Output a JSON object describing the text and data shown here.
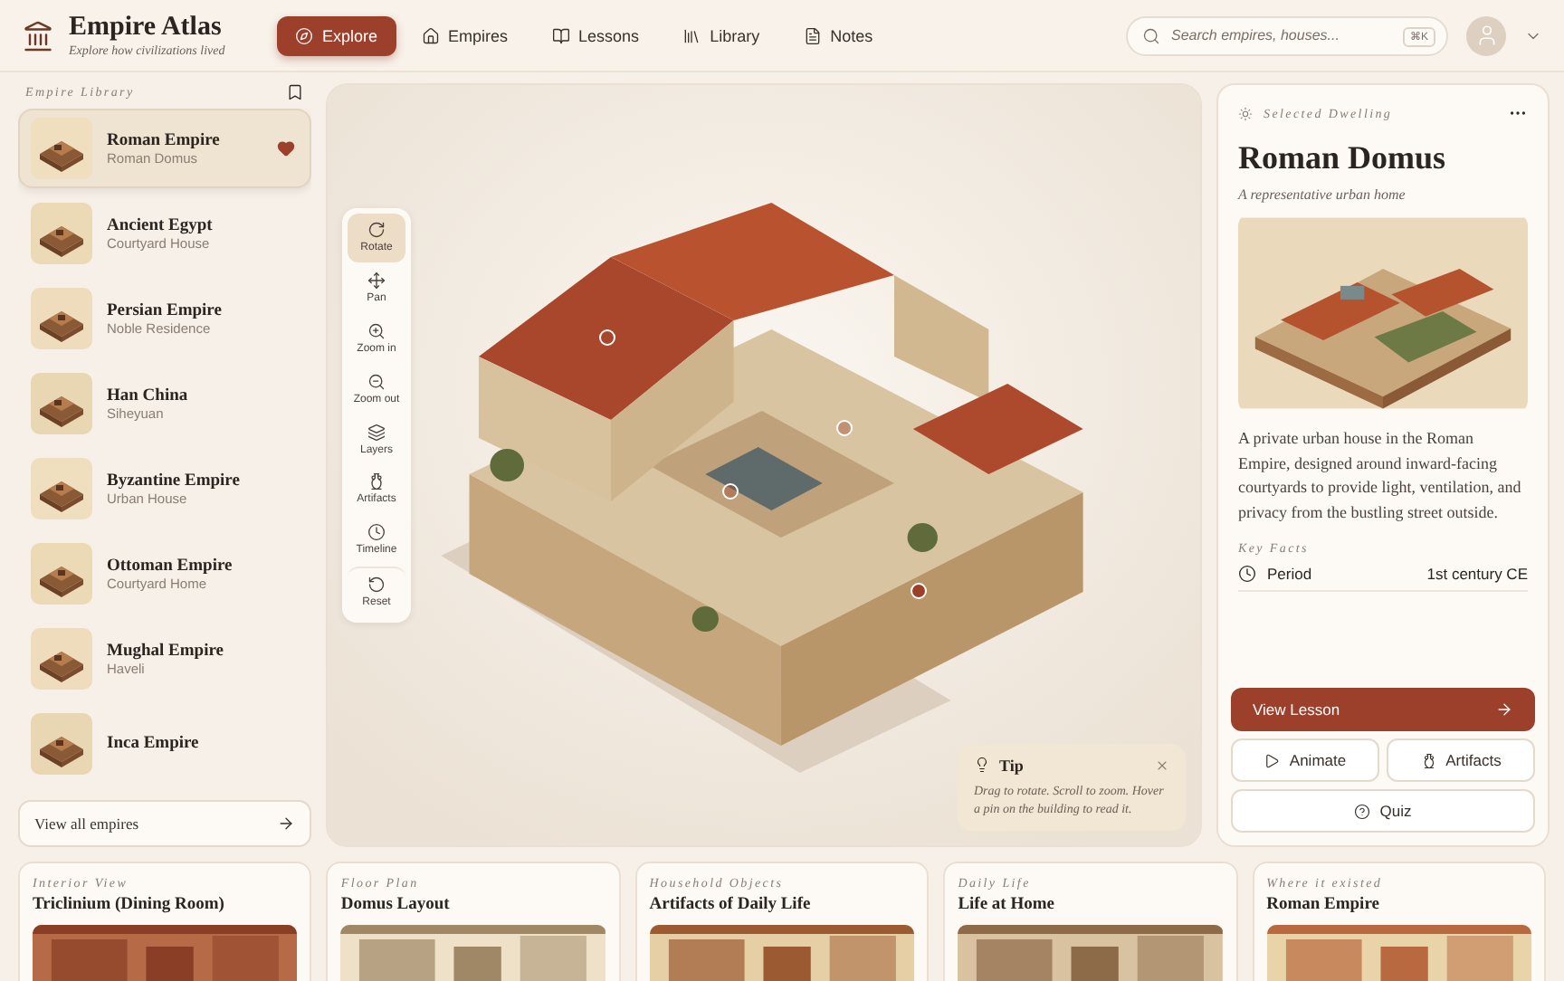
{
  "header": {
    "title": "Empire Atlas",
    "subtitle": "Explore how civilizations lived",
    "nav": [
      {
        "label": "Explore",
        "selected": true
      },
      {
        "label": "Empires",
        "selected": false
      },
      {
        "label": "Lessons",
        "selected": false
      },
      {
        "label": "Library",
        "selected": false
      },
      {
        "label": "Notes",
        "selected": false
      }
    ],
    "search": {
      "placeholder": "Search empires, houses...",
      "shortcut": "⌘K"
    }
  },
  "sidebar": {
    "heading": "Empire Library",
    "items": [
      {
        "name": "Roman Empire",
        "dwelling": "Roman Domus",
        "selected": true,
        "favorite": true
      },
      {
        "name": "Ancient Egypt",
        "dwelling": "Courtyard House",
        "selected": false,
        "favorite": false
      },
      {
        "name": "Persian Empire",
        "dwelling": "Noble Residence",
        "selected": false,
        "favorite": false
      },
      {
        "name": "Han China",
        "dwelling": "Siheyuan",
        "selected": false,
        "favorite": false
      },
      {
        "name": "Byzantine Empire",
        "dwelling": "Urban House",
        "selected": false,
        "favorite": false
      },
      {
        "name": "Ottoman Empire",
        "dwelling": "Courtyard Home",
        "selected": false,
        "favorite": false
      },
      {
        "name": "Mughal Empire",
        "dwelling": "Haveli",
        "selected": false,
        "favorite": false
      },
      {
        "name": "Inca Empire",
        "selected": false,
        "favorite": false
      }
    ],
    "view_all": "View all empires"
  },
  "viewer": {
    "tools": [
      {
        "label": "Rotate",
        "selected": true
      },
      {
        "label": "Pan",
        "selected": false
      },
      {
        "label": "Zoom in",
        "selected": false
      },
      {
        "label": "Zoom out",
        "selected": false
      },
      {
        "label": "Layers",
        "selected": false
      },
      {
        "label": "Artifacts",
        "selected": false
      },
      {
        "label": "Timeline",
        "selected": false
      },
      {
        "label": "Reset",
        "selected": false
      }
    ],
    "tip": {
      "title": "Tip",
      "text": "Drag to rotate. Scroll to zoom. Hover a pin on the building to read it."
    }
  },
  "panel": {
    "eyebrow": "Selected Dwelling",
    "title": "Roman Domus",
    "subtitle": "A representative urban home",
    "description": "A private urban house in the Roman Empire, designed around inward-facing courtyards to provide light, ventilation, and privacy from the bustling street outside.",
    "facts_heading": "Key Facts",
    "facts": [
      {
        "label": "Period",
        "value": "1st century CE"
      }
    ],
    "primary": "View Lesson",
    "actions": [
      "Animate",
      "Artifacts"
    ],
    "quiz": "Quiz"
  },
  "cards": [
    {
      "eyebrow": "Interior View",
      "title": "Triclinium (Dining Room)"
    },
    {
      "eyebrow": "Floor Plan",
      "title": "Domus Layout"
    },
    {
      "eyebrow": "Household Objects",
      "title": "Artifacts of Daily Life"
    },
    {
      "eyebrow": "Daily Life",
      "title": "Life at Home"
    },
    {
      "eyebrow": "Where it existed",
      "title": "Roman Empire"
    }
  ]
}
